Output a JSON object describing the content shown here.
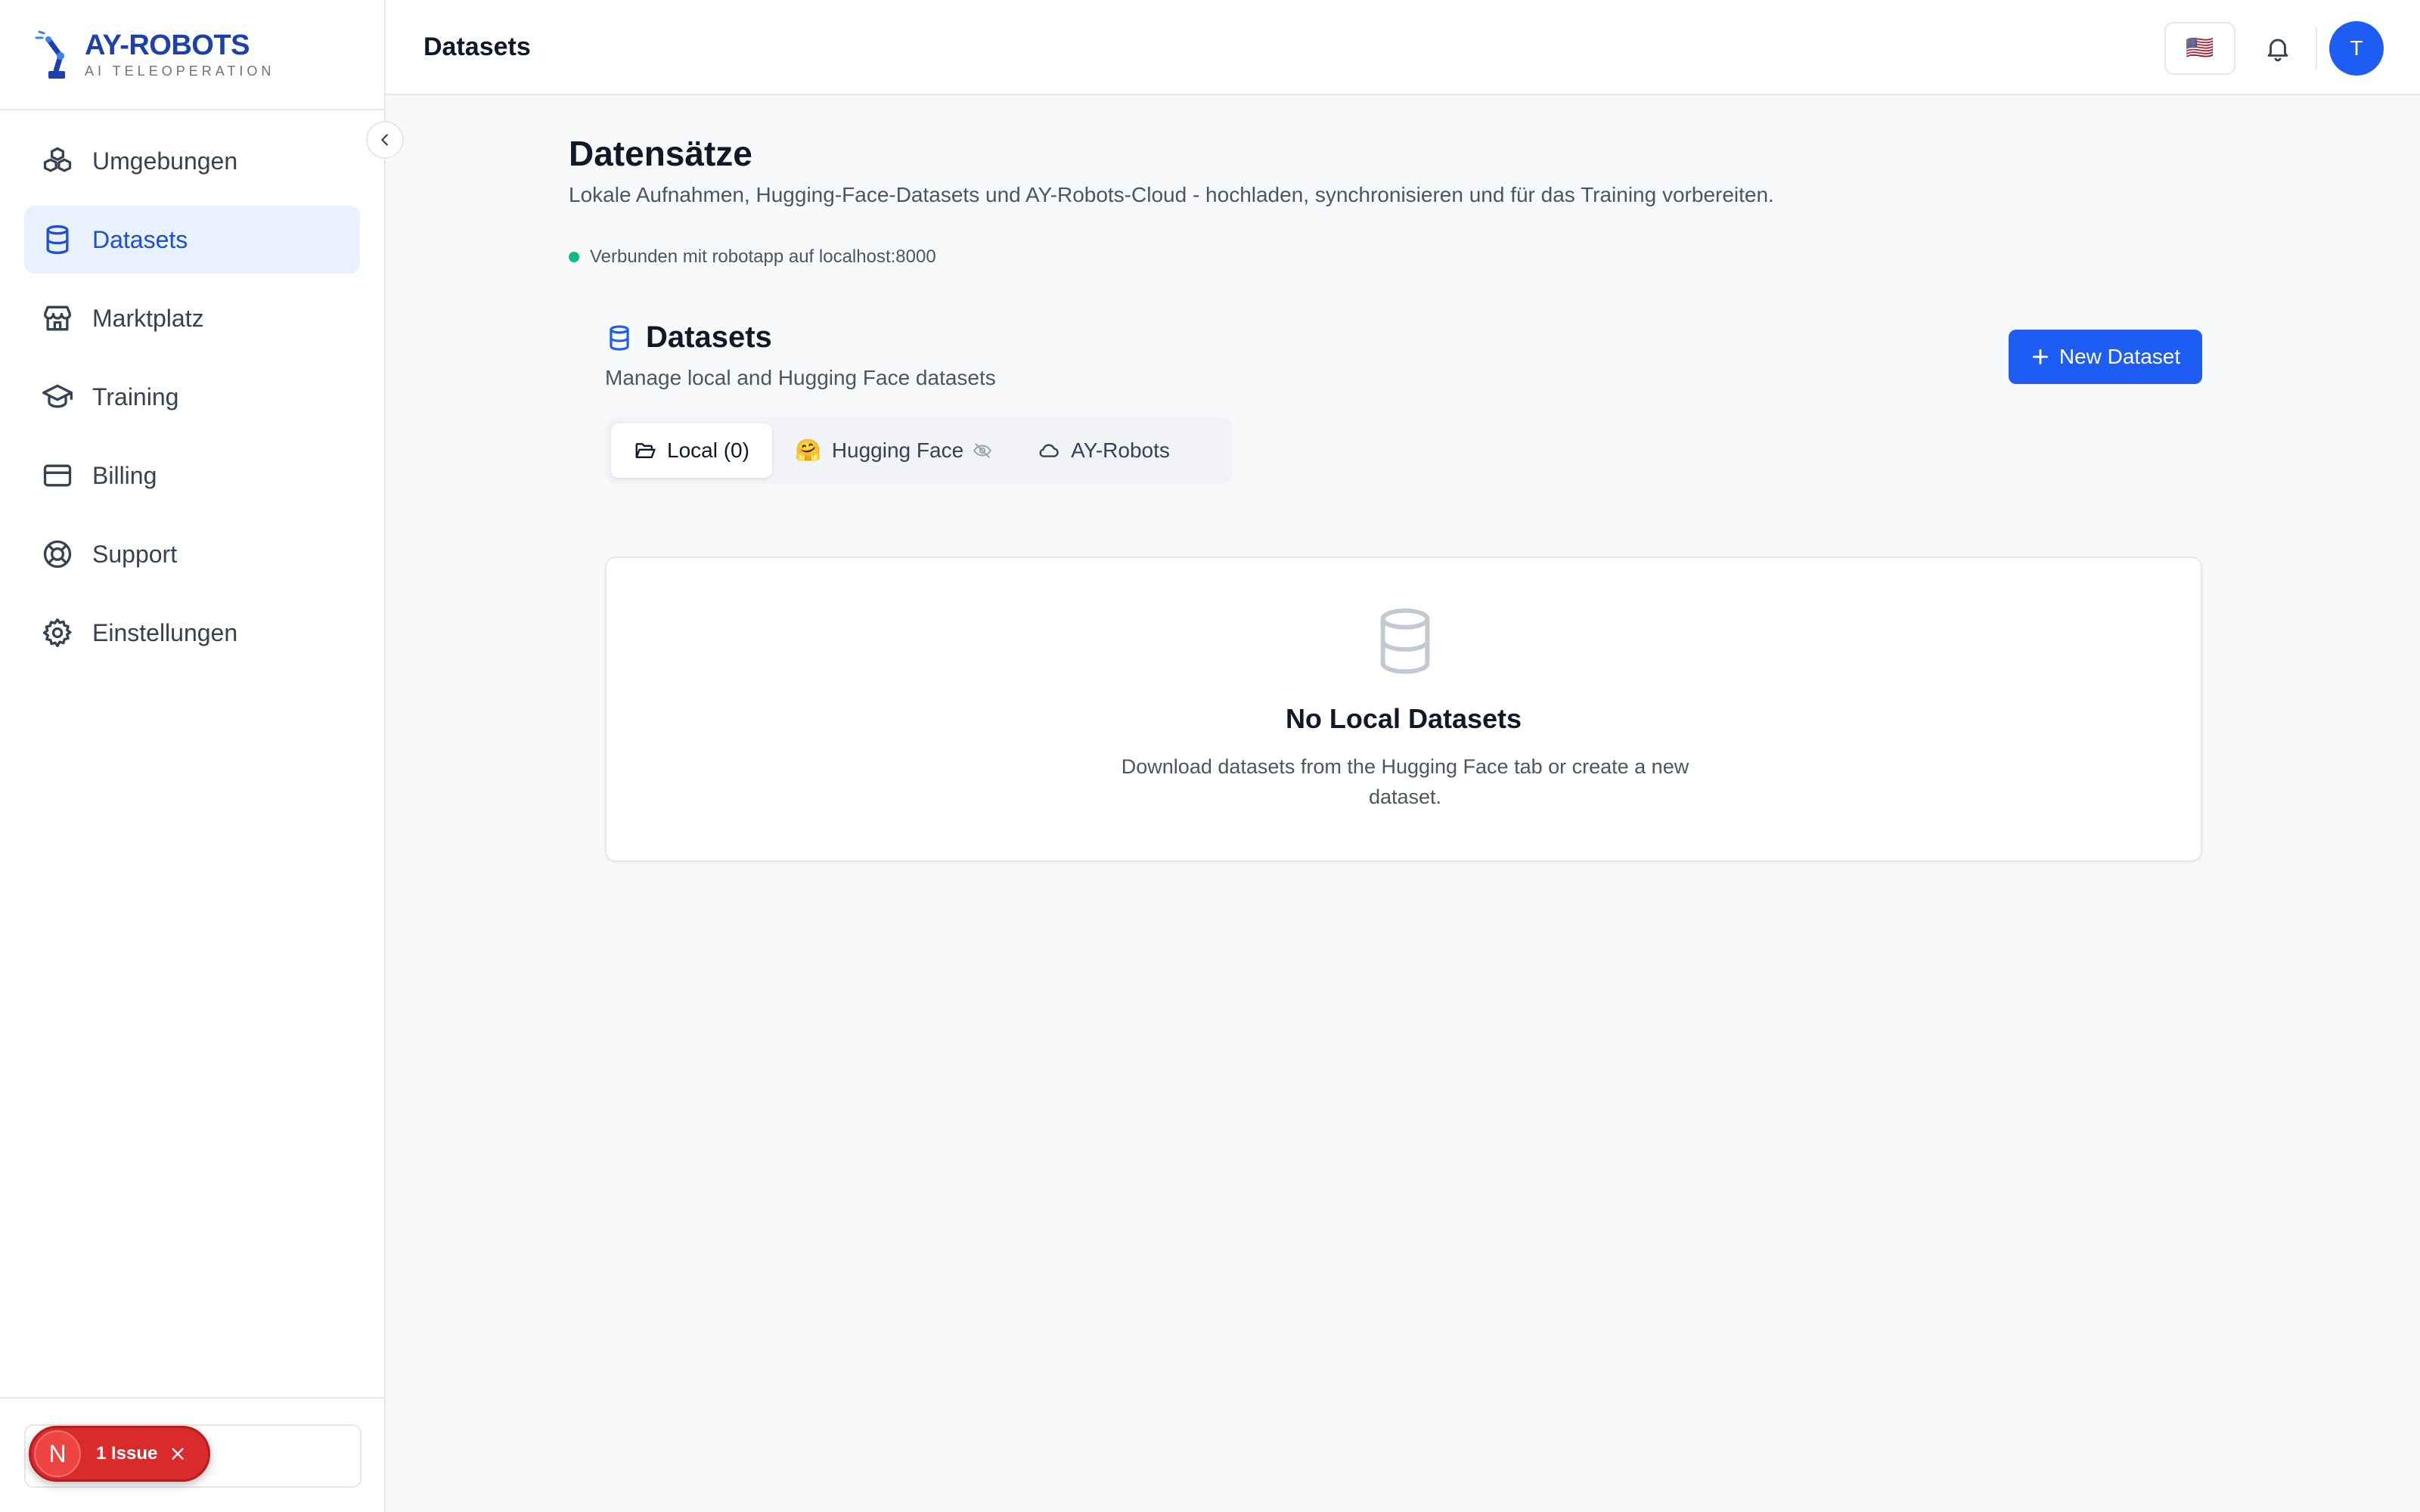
{
  "brand": {
    "name": "AY-ROBOTS",
    "tagline": "AI TELEOPERATION"
  },
  "sidebar": {
    "items": [
      {
        "label": "Umgebungen",
        "icon": "cubes-icon",
        "active": false
      },
      {
        "label": "Datasets",
        "icon": "database-icon",
        "active": true
      },
      {
        "label": "Marktplatz",
        "icon": "store-icon",
        "active": false
      },
      {
        "label": "Training",
        "icon": "graduation-cap-icon",
        "active": false
      },
      {
        "label": "Billing",
        "icon": "credit-card-icon",
        "active": false
      },
      {
        "label": "Support",
        "icon": "lifebuoy-icon",
        "active": false
      },
      {
        "label": "Einstellungen",
        "icon": "gear-icon",
        "active": false
      }
    ],
    "issue_badge": {
      "letter": "N",
      "label": "1 Issue"
    }
  },
  "header": {
    "title": "Datasets",
    "language_flag": "🇺🇸",
    "avatar_initial": "T"
  },
  "main": {
    "title": "Datensätze",
    "subtitle": "Lokale Aufnahmen, Hugging-Face-Datasets und AY-Robots-Cloud - hochladen, synchronisieren und für das Training vorbereiten.",
    "status": "Verbunden mit robotapp auf localhost:8000",
    "section": {
      "title": "Datasets",
      "subtitle": "Manage local and Hugging Face datasets",
      "new_button": "New Dataset"
    },
    "tabs": [
      {
        "label": "Local (0)",
        "active": true
      },
      {
        "label": "Hugging Face",
        "emoji": "🤗",
        "active": false
      },
      {
        "label": "AY-Robots",
        "active": false
      }
    ],
    "empty_state": {
      "title": "No Local Datasets",
      "description": "Download datasets from the Hugging Face tab or create a new dataset."
    }
  },
  "colors": {
    "accent": "#1d5df3",
    "brand": "#1e40af",
    "active_bg": "#eaf1fe",
    "status_ok": "#10b981",
    "issue": "#d92b2b"
  }
}
